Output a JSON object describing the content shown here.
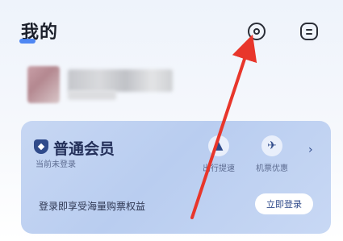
{
  "header": {
    "title": "我的"
  },
  "icons": {
    "settings": "settings-icon",
    "message": "message-icon"
  },
  "membership": {
    "title": "普通会员",
    "status": "当前未登录",
    "benefits": [
      {
        "label": "出行提速",
        "icon": "rocket-icon"
      },
      {
        "label": "机票优惠",
        "icon": "plane-icon"
      }
    ],
    "promo_text": "登录即享受海量购票权益",
    "login_button": "立即登录"
  },
  "colors": {
    "accent": "#3d7bf2",
    "card": "#c0d2f2",
    "arrow": "#e8362b"
  }
}
